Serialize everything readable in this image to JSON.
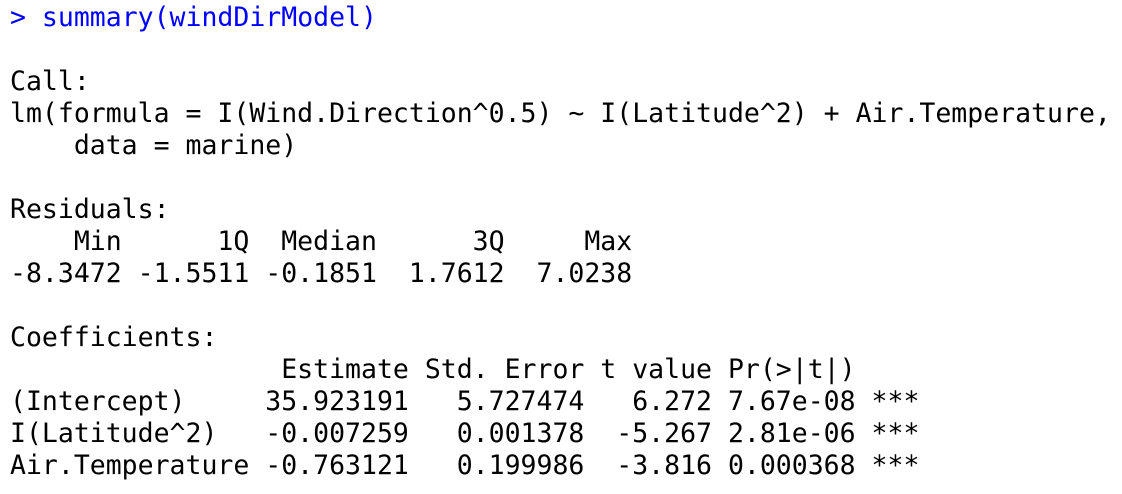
{
  "console": {
    "prompt": "> ",
    "command": "summary(windDirModel)",
    "accent_color": "#0000ff",
    "lines": [
      "",
      "Call:",
      "lm(formula = I(Wind.Direction^0.5) ~ I(Latitude^2) + Air.Temperature,",
      "    data = marine)",
      "",
      "Residuals:",
      "    Min      1Q  Median      3Q     Max ",
      "-8.3472 -1.5511 -0.1851  1.7612  7.0238 ",
      "",
      "Coefficients:",
      "                 Estimate Std. Error t value Pr(>|t|)    ",
      "(Intercept)     35.923191   5.727474   6.272 7.67e-08 ***",
      "I(Latitude^2)   -0.007259   0.001378  -5.267 2.81e-06 ***",
      "Air.Temperature -0.763121   0.199986  -3.816 0.000368 ***"
    ]
  }
}
